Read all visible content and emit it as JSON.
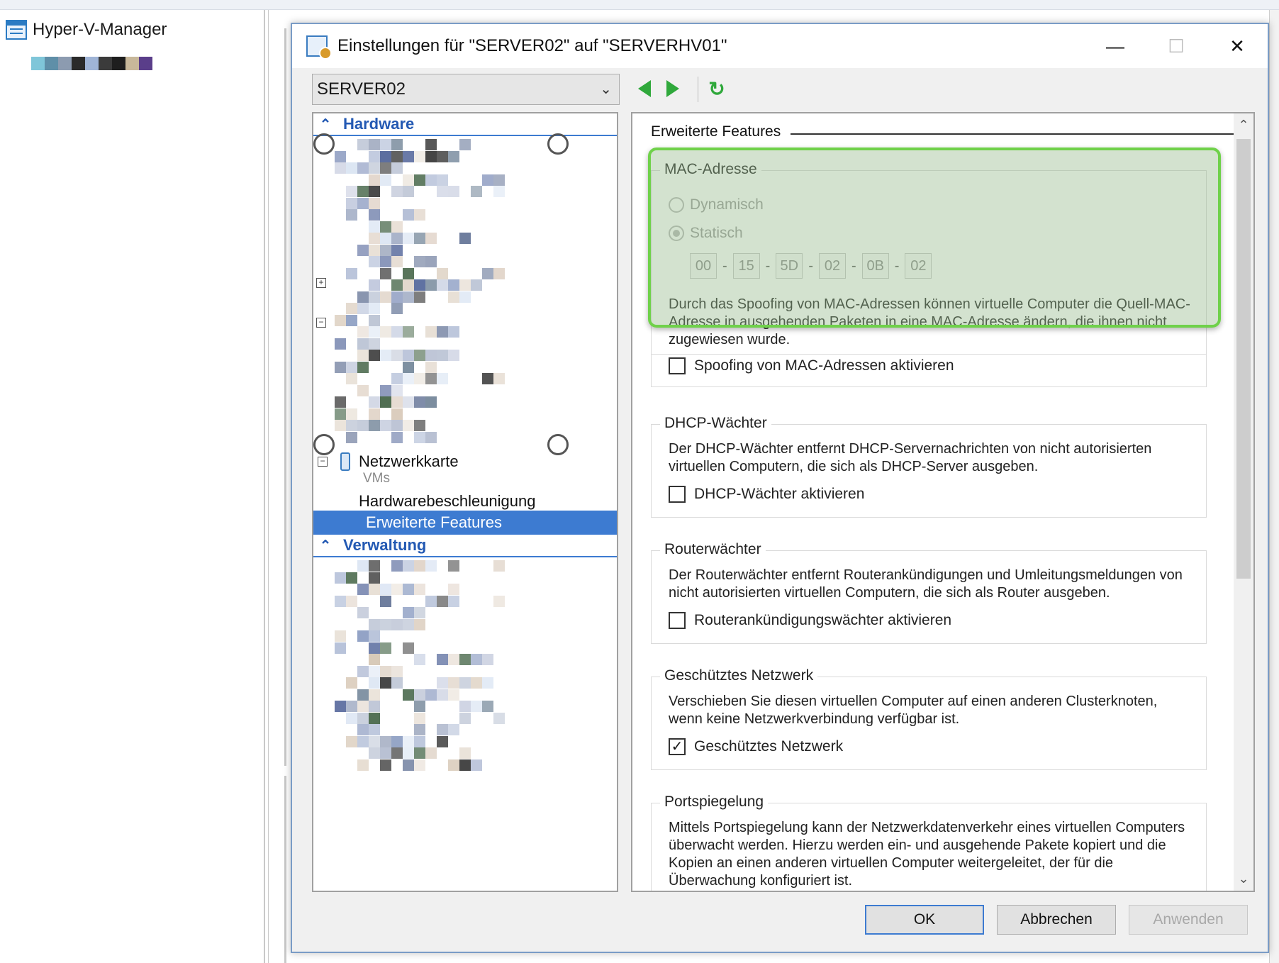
{
  "app": {
    "title": "Hyper-V-Manager",
    "left_mosaic_colors": [
      "#7fc6d9",
      "#5f8fa8",
      "#8c9bb0",
      "#2a2a2a",
      "#9fb4d6",
      "#3b3b3b",
      "#1e1e1e",
      "#c8b89a",
      "#5a3e8a"
    ]
  },
  "dialog": {
    "title": "Einstellungen für \"SERVER02\" auf \"SERVERHV01\"",
    "minimize_glyph": "—",
    "maximize_glyph": "☐",
    "close_glyph": "✕"
  },
  "toolbar": {
    "vm_selected": "SERVER02",
    "combo_chevron": "⌄",
    "back_icon": "left-arrow-icon",
    "forward_icon": "right-arrow-icon",
    "refresh_glyph": "↻"
  },
  "tree": {
    "hardware_header": "Hardware",
    "hardware_chevron": "⌃",
    "netcard_label": "Netzwerkkarte",
    "netcard_sub": "VMs",
    "hw_accel": "Hardwarebeschleunigung",
    "advanced_features": "Erweiterte Features",
    "management_header": "Verwaltung",
    "management_chevron": "⌃",
    "expander_minus": "−",
    "expander_plus": "+"
  },
  "settings": {
    "section_title": "Erweiterte Features",
    "mac": {
      "title": "MAC-Adresse",
      "dynamic_label": "Dynamisch",
      "static_label": "Statisch",
      "static_selected": true,
      "octets": [
        "00",
        "15",
        "5D",
        "02",
        "0B",
        "02"
      ],
      "separator": "-",
      "desc": "Durch das Spoofing von MAC-Adressen können virtuelle Computer die Quell-MAC-Adresse in ausgehenden Paketen in eine MAC-Adresse ändern, die ihnen nicht zugewiesen wurde.",
      "spoof_label": "Spoofing von MAC-Adressen aktivieren",
      "spoof_checked": false
    },
    "dhcp": {
      "title": "DHCP-Wächter",
      "desc": "Der DHCP-Wächter entfernt DHCP-Servernachrichten von nicht autorisierten virtuellen Computern, die sich als DHCP-Server ausgeben.",
      "check_label": "DHCP-Wächter aktivieren",
      "checked": false
    },
    "router": {
      "title": "Routerwächter",
      "desc": "Der Routerwächter entfernt Routerankündigungen und Umleitungsmeldungen von nicht autorisierten virtuellen Computern, die sich als Router ausgeben.",
      "check_label": "Routerankündigungswächter aktivieren",
      "checked": false
    },
    "protected": {
      "title": "Geschütztes Netzwerk",
      "desc": "Verschieben Sie diesen virtuellen Computer auf einen anderen Clusterknoten, wenn keine Netzwerkverbindung verfügbar ist.",
      "check_label": "Geschütztes Netzwerk",
      "checked": true,
      "check_glyph": "✓"
    },
    "mirroring": {
      "title": "Portspiegelung",
      "desc": "Mittels Portspiegelung kann der Netzwerkdatenverkehr eines virtuellen Computers überwacht werden. Hierzu werden ein- und ausgehende Pakete kopiert und die Kopien an einen anderen virtuellen Computer weitergeleitet, der für die Überwachung konfiguriert ist."
    },
    "scroll_up": "⌃",
    "scroll_down": "⌄"
  },
  "buttons": {
    "ok": "OK",
    "cancel": "Abbrechen",
    "apply": "Anwenden"
  },
  "colors": {
    "accent": "#3d7bd1",
    "highlight_border": "#6fd14a",
    "nav_green": "#2fa83b"
  }
}
